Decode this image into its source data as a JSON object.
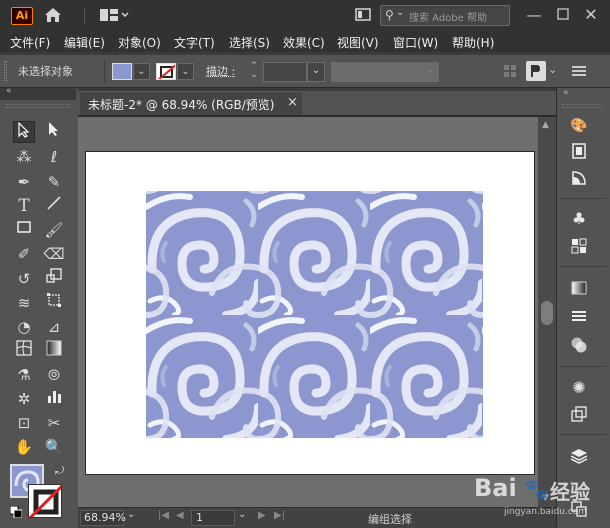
{
  "app": {
    "logo": "Ai",
    "search_placeholder": "搜索 Adobe 帮助"
  },
  "menu": [
    "文件(F)",
    "编辑(E)",
    "对象(O)",
    "文字(T)",
    "选择(S)",
    "效果(C)",
    "视图(V)",
    "窗口(W)",
    "帮助(H)"
  ],
  "control_bar": {
    "selection_status": "未选择对象",
    "stroke_label": "描边 :"
  },
  "document": {
    "tab_title": "未标题-2* @ 68.94% (RGB/预览)",
    "close_glyph": "×"
  },
  "status": {
    "zoom": "68.94%",
    "page": "1",
    "mode": "编组选择"
  },
  "watermark": {
    "line1": "Bai",
    "line2": "经验",
    "url": "jingyan.baidu.com"
  },
  "colors": {
    "pattern_fill": "#8c96cf",
    "pattern_swirl": "#e4e7f5"
  },
  "icons": {
    "home": "home-icon",
    "search": "search-icon"
  }
}
